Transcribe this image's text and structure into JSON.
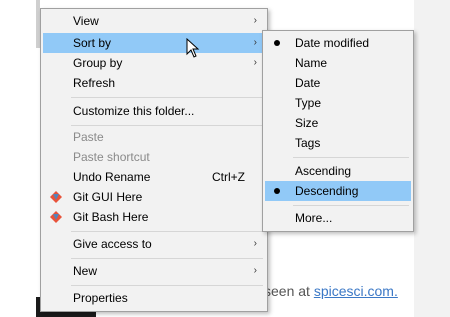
{
  "background": {
    "text_before_link": "seen at ",
    "link_text": "spicesci.com."
  },
  "context_menu": {
    "view": "View",
    "sort_by": "Sort by",
    "group_by": "Group by",
    "refresh": "Refresh",
    "customize": "Customize this folder...",
    "paste": "Paste",
    "paste_shortcut": "Paste shortcut",
    "undo_rename": "Undo Rename",
    "undo_shortcut": "Ctrl+Z",
    "git_gui": "Git GUI Here",
    "git_bash": "Git Bash Here",
    "give_access": "Give access to",
    "new": "New",
    "properties": "Properties",
    "submenu_arrow": "›"
  },
  "sort_submenu": {
    "date_modified": "Date modified",
    "name": "Name",
    "date": "Date",
    "type": "Type",
    "size": "Size",
    "tags": "Tags",
    "ascending": "Ascending",
    "descending": "Descending",
    "more": "More..."
  },
  "colors": {
    "hover": "#91c9f7",
    "git_red": "#e8533b",
    "git_blue": "#3c8ccf"
  }
}
